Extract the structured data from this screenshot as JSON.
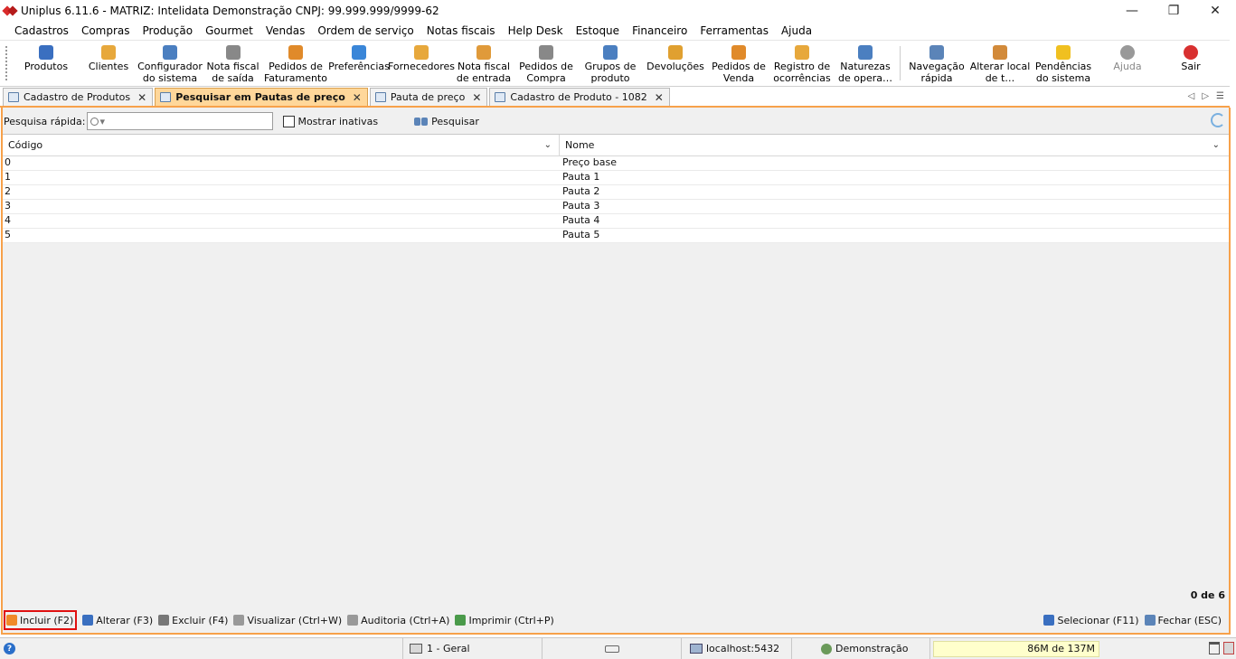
{
  "window": {
    "title": "Uniplus 6.11.6 - MATRIZ: Intelidata Demonstração CNPJ: 99.999.999/9999-62",
    "minimize": "—",
    "restore": "❐",
    "close": "✕"
  },
  "menu": [
    "Cadastros",
    "Compras",
    "Produção",
    "Gourmet",
    "Vendas",
    "Ordem de serviço",
    "Notas fiscais",
    "Help Desk",
    "Estoque",
    "Financeiro",
    "Ferramentas",
    "Ajuda"
  ],
  "toolbar": [
    {
      "label": "Produtos",
      "icon": "box-icon",
      "color": "#3a6fc0"
    },
    {
      "label": "Clientes",
      "icon": "person-icon",
      "color": "#e7a83c"
    },
    {
      "label": "Configurador\ndo sistema",
      "icon": "config-icon",
      "color": "#4b7fc0"
    },
    {
      "label": "Nota fiscal\nde saída",
      "icon": "invoice-out-icon",
      "color": "#888888"
    },
    {
      "label": "Pedidos de\nFaturamento",
      "icon": "order-billing-icon",
      "color": "#e08a2a"
    },
    {
      "label": "Preferências",
      "icon": "preferences-icon",
      "color": "#3a86d8"
    },
    {
      "label": "Fornecedores",
      "icon": "supplier-icon",
      "color": "#e7a83c"
    },
    {
      "label": "Nota fiscal\nde entrada",
      "icon": "invoice-in-icon",
      "color": "#e09a3a"
    },
    {
      "label": "Pedidos de\nCompra",
      "icon": "purchase-order-icon",
      "color": "#888888"
    },
    {
      "label": "Grupos de\nproduto",
      "icon": "product-group-icon",
      "color": "#4b7fc0"
    },
    {
      "label": "Devoluções",
      "icon": "returns-icon",
      "color": "#e0a030"
    },
    {
      "label": "Pedidos de\nVenda",
      "icon": "sales-order-icon",
      "color": "#e08a2a"
    },
    {
      "label": "Registro de\nocorrências",
      "icon": "occurrence-icon",
      "color": "#e7a83c"
    },
    {
      "label": "Naturezas\nde opera…",
      "icon": "operation-nature-icon",
      "color": "#4b7fc0"
    }
  ],
  "toolbar2": [
    {
      "label": "Navegação\nrápida",
      "icon": "quick-nav-icon",
      "color": "#5b84b8"
    },
    {
      "label": "Alterar local\nde t…",
      "icon": "home-icon",
      "color": "#d28a3a"
    },
    {
      "label": "Pendências\ndo sistema",
      "icon": "warning-icon",
      "color": "#f0c020"
    },
    {
      "label": "Ajuda",
      "icon": "help-icon",
      "color": "#999999",
      "disabled": true
    },
    {
      "label": "Sair",
      "icon": "power-icon",
      "color": "#d83030"
    }
  ],
  "tabs": [
    {
      "label": "Cadastro de Produtos",
      "active": false
    },
    {
      "label": "Pesquisar em Pautas de preço",
      "active": true
    },
    {
      "label": "Pauta de preço",
      "active": false
    },
    {
      "label": "Cadastro de Produto - 1082",
      "active": false
    }
  ],
  "tab_close": "✕",
  "search": {
    "label": "Pesquisa rápida:",
    "placeholder_glyph": "▾",
    "show_inactive": "Mostrar inativas",
    "button": "Pesquisar"
  },
  "grid": {
    "columns": [
      "Código",
      "Nome"
    ],
    "rows": [
      [
        "0",
        "Preço base"
      ],
      [
        "1",
        "Pauta 1"
      ],
      [
        "2",
        "Pauta 2"
      ],
      [
        "3",
        "Pauta 3"
      ],
      [
        "4",
        "Pauta 4"
      ],
      [
        "5",
        "Pauta 5"
      ]
    ],
    "count": "0 de 6"
  },
  "actions": [
    {
      "label": "Incluir (F2)",
      "icon": "add-icon",
      "color": "#f08a2a"
    },
    {
      "label": "Alterar (F3)",
      "icon": "edit-icon",
      "color": "#3a6fc0"
    },
    {
      "label": "Excluir (F4)",
      "icon": "delete-icon",
      "color": "#777777"
    },
    {
      "label": "Visualizar (Ctrl+W)",
      "icon": "view-icon",
      "color": "#999999"
    },
    {
      "label": "Auditoria (Ctrl+A)",
      "icon": "audit-icon",
      "color": "#999999"
    },
    {
      "label": "Imprimir (Ctrl+P)",
      "icon": "print-icon",
      "color": "#4a9a4a"
    }
  ],
  "actions_right": [
    {
      "label": "Selecionar (F11)",
      "icon": "select-icon",
      "color": "#3a6fc0"
    },
    {
      "label": "Fechar (ESC)",
      "icon": "close-window-icon",
      "color": "#5b84b8"
    }
  ],
  "status": {
    "help": "?",
    "module": "1 - Geral",
    "server": "localhost:5432",
    "user": "Demonstração",
    "memory": "86M de 137M"
  }
}
